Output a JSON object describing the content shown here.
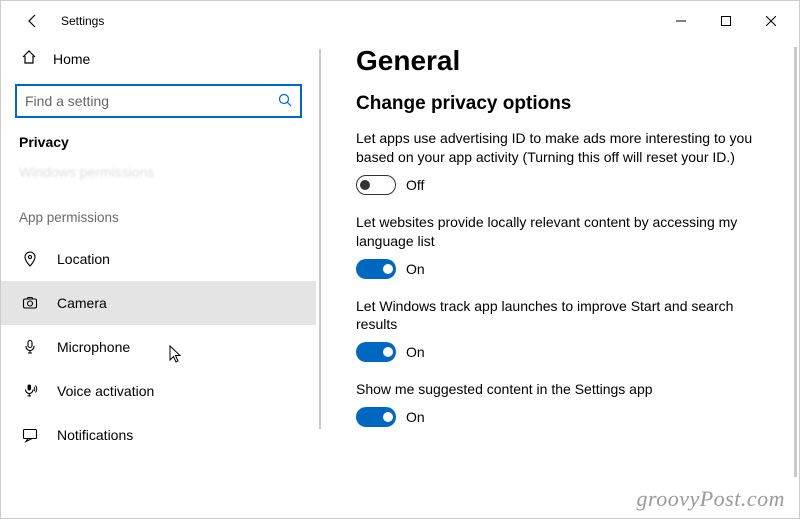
{
  "titlebar": {
    "app": "Settings"
  },
  "sidebar": {
    "home": "Home",
    "search_placeholder": "Find a setting",
    "category": "Privacy",
    "faded": "Windows permissions",
    "group": "App permissions",
    "items": [
      {
        "label": "Location"
      },
      {
        "label": "Camera"
      },
      {
        "label": "Microphone"
      },
      {
        "label": "Voice activation"
      },
      {
        "label": "Notifications"
      }
    ]
  },
  "main": {
    "heading": "General",
    "subheading": "Change privacy options",
    "toggle_on": "On",
    "toggle_off": "Off",
    "settings": [
      {
        "desc": "Let apps use advertising ID to make ads more interesting to you based on your app activity (Turning this off will reset your ID.)",
        "state": "off"
      },
      {
        "desc": "Let websites provide locally relevant content by accessing my language list",
        "state": "on"
      },
      {
        "desc": "Let Windows track app launches to improve Start and search results",
        "state": "on"
      },
      {
        "desc": "Show me suggested content in the Settings app",
        "state": "on"
      }
    ]
  },
  "watermark": "groovyPost.com"
}
